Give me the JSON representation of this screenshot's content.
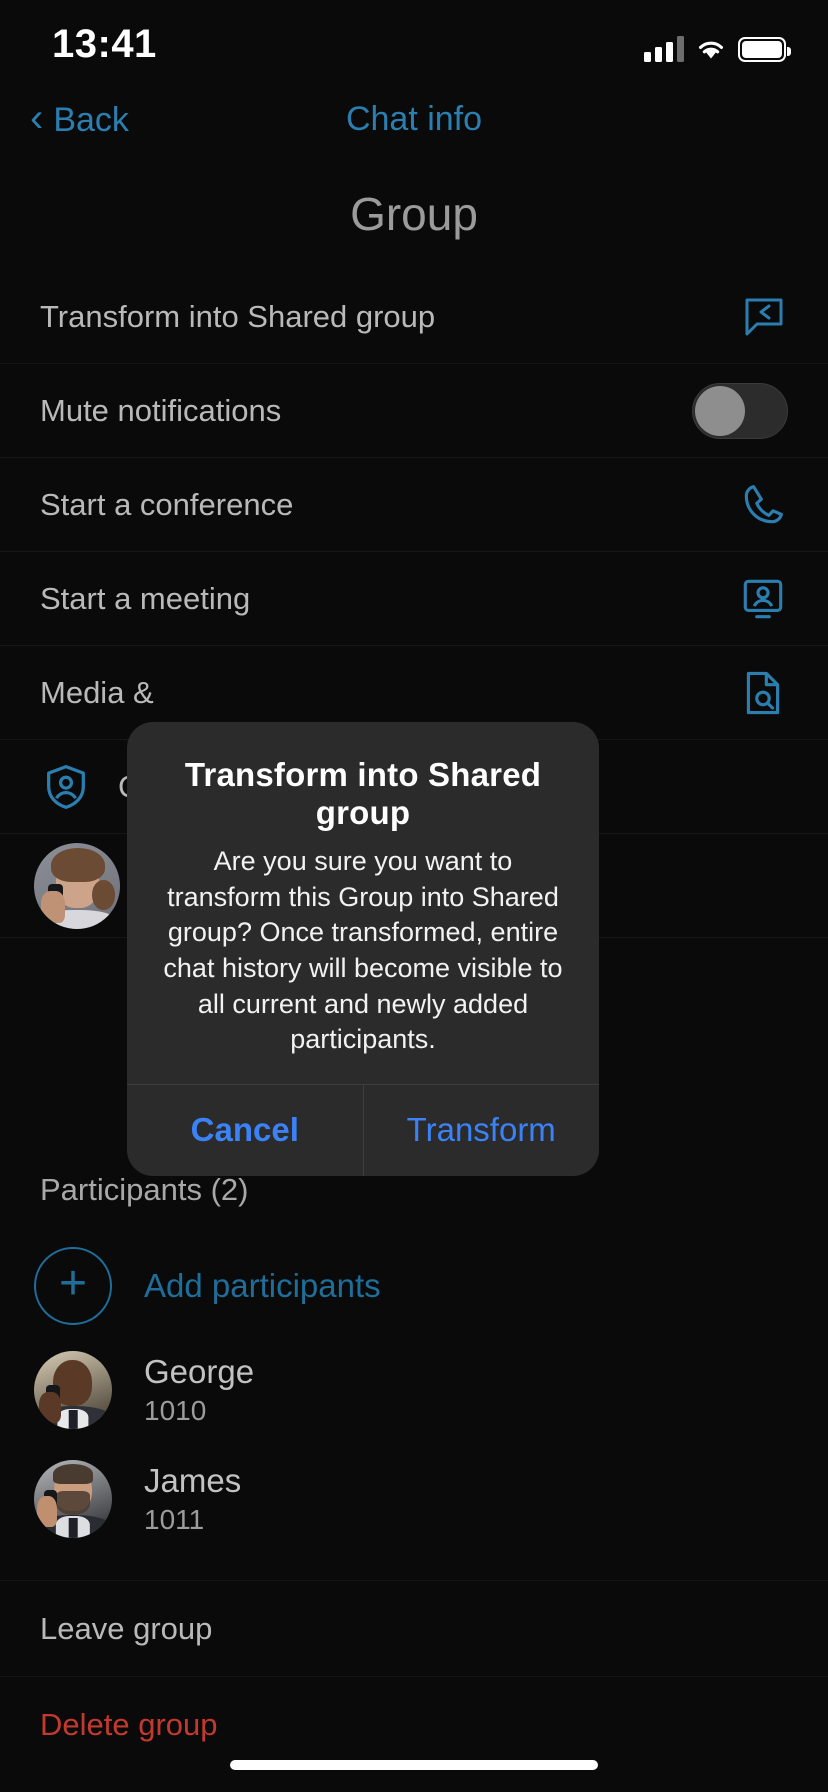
{
  "status_bar": {
    "time": "13:41",
    "cellular_icon": "signal-bars-icon",
    "wifi_icon": "wifi-icon",
    "battery_icon": "battery-icon"
  },
  "nav": {
    "back_label": "Back",
    "back_icon": "chevron-left-icon",
    "title": "Chat info"
  },
  "header": {
    "group_name": "Group"
  },
  "settings_rows": [
    {
      "label": "Transform into Shared group",
      "icon": "share-chat-bubble-icon",
      "type": "action"
    },
    {
      "label": "Mute notifications",
      "icon": "toggle-switch",
      "type": "toggle",
      "toggle_on": false
    },
    {
      "label": "Start a conference",
      "icon": "phone-handset-icon",
      "type": "action"
    },
    {
      "label": "Start a meeting",
      "icon": "person-in-monitor-icon",
      "type": "action"
    },
    {
      "label": "Media &",
      "icon": "document-search-icon",
      "type": "action"
    }
  ],
  "admins_row": {
    "label": "Cha",
    "icon": "shield-person-icon"
  },
  "participants": {
    "heading": "Participants (2)",
    "add_label": "Add participants",
    "add_icon": "plus-circle-icon",
    "items": [
      {
        "name": "George",
        "extension": "1010",
        "avatar": "avatar-george"
      },
      {
        "name": "James",
        "extension": "1011",
        "avatar": "avatar-james"
      }
    ]
  },
  "footer_rows": [
    {
      "label": "Leave group",
      "style": "normal"
    },
    {
      "label": "Delete group",
      "style": "destructive"
    }
  ],
  "dialog": {
    "title": "Transform into Shared group",
    "message": "Are you sure you want to transform this Group into Shared group? Once transformed, entire chat history will become visible to all current and newly added participants.",
    "cancel_label": "Cancel",
    "confirm_label": "Transform"
  },
  "colors": {
    "accent_blue": "#2a7fb0",
    "dialog_blue": "#3b82f6",
    "destructive_red": "#c2392f",
    "background": "#0a0a0a",
    "dialog_background": "#2b2b2b"
  }
}
